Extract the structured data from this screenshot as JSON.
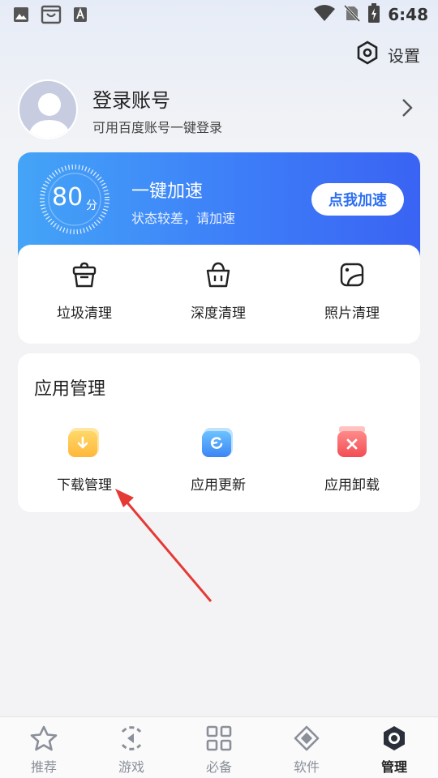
{
  "status_bar": {
    "time": "6:48"
  },
  "header": {
    "settings_label": "设置"
  },
  "profile": {
    "title": "登录账号",
    "subtitle": "可用百度账号一键登录"
  },
  "boost": {
    "score": "80",
    "score_unit": "分",
    "title": "一键加速",
    "subtitle": "状态较差，请加速",
    "button_label": "点我加速"
  },
  "clean_tools": [
    {
      "label": "垃圾清理",
      "icon": "trash-basket-icon"
    },
    {
      "label": "深度清理",
      "icon": "shopping-basket-icon"
    },
    {
      "label": "照片清理",
      "icon": "photo-icon"
    }
  ],
  "app_management": {
    "title": "应用管理",
    "items": [
      {
        "label": "下载管理",
        "icon": "download-folder-icon"
      },
      {
        "label": "应用更新",
        "icon": "update-icon"
      },
      {
        "label": "应用卸载",
        "icon": "uninstall-icon"
      }
    ]
  },
  "bottom_nav": [
    {
      "label": "推荐",
      "icon": "star-icon"
    },
    {
      "label": "游戏",
      "icon": "game-icon"
    },
    {
      "label": "必备",
      "icon": "grid-icon"
    },
    {
      "label": "软件",
      "icon": "diamond-icon"
    },
    {
      "label": "管理",
      "icon": "manage-icon",
      "active": true
    }
  ],
  "colors": {
    "accent": "#3d7ef8",
    "annotation_arrow": "#e53935"
  }
}
